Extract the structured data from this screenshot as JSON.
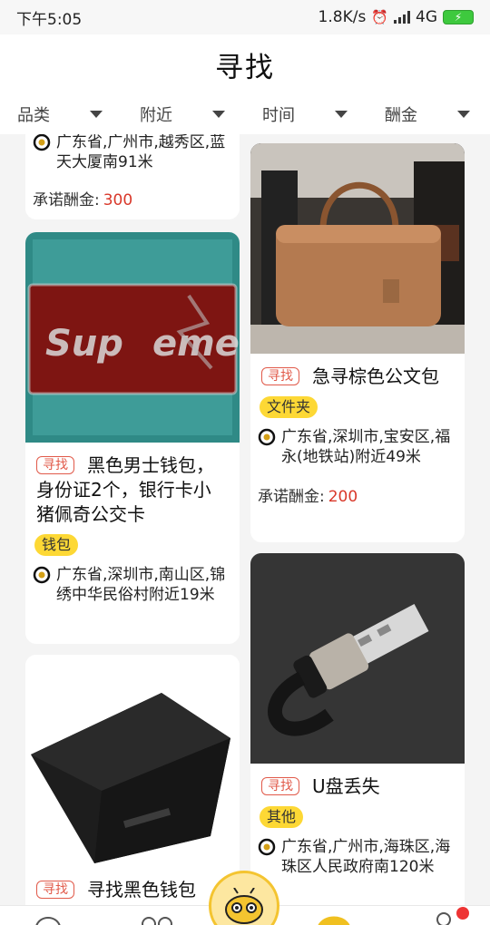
{
  "status": {
    "time": "下午5:05",
    "speed": "1.8K/s",
    "network": "4G"
  },
  "header": {
    "title": "寻找"
  },
  "filters": [
    "品类",
    "附近",
    "时间",
    "酬金"
  ],
  "colors": {
    "tag": "#e15a4a",
    "pill": "#fdd835",
    "reward": "#d9382a"
  },
  "cards": {
    "c1": {
      "location": "广东省,广州市,越秀区,蓝天大厦南91米",
      "reward_label": "承诺酬金:",
      "reward": "300"
    },
    "c2": {
      "tag": "寻找",
      "title": "急寻棕色公文包",
      "category": "文件夹",
      "location": "广东省,深圳市,宝安区,福永(地铁站)附近49米",
      "reward_label": "承诺酬金:",
      "reward": "200"
    },
    "c3": {
      "tag": "寻找",
      "title": "黑色男士钱包，身份证2个，银行卡小猪佩奇公交卡",
      "category": "钱包",
      "location": "广东省,深圳市,南山区,锦绣中华民俗村附近19米"
    },
    "c4": {
      "tag": "寻找",
      "title": "U盘丢失",
      "category": "其他",
      "location": "广东省,广州市,海珠区,海珠区人民政府南120米"
    },
    "c5": {
      "tag": "寻找",
      "title": "寻找黑色钱包"
    }
  },
  "icons": {
    "location": "location-target-icon",
    "center": "bee-mascot-icon"
  }
}
